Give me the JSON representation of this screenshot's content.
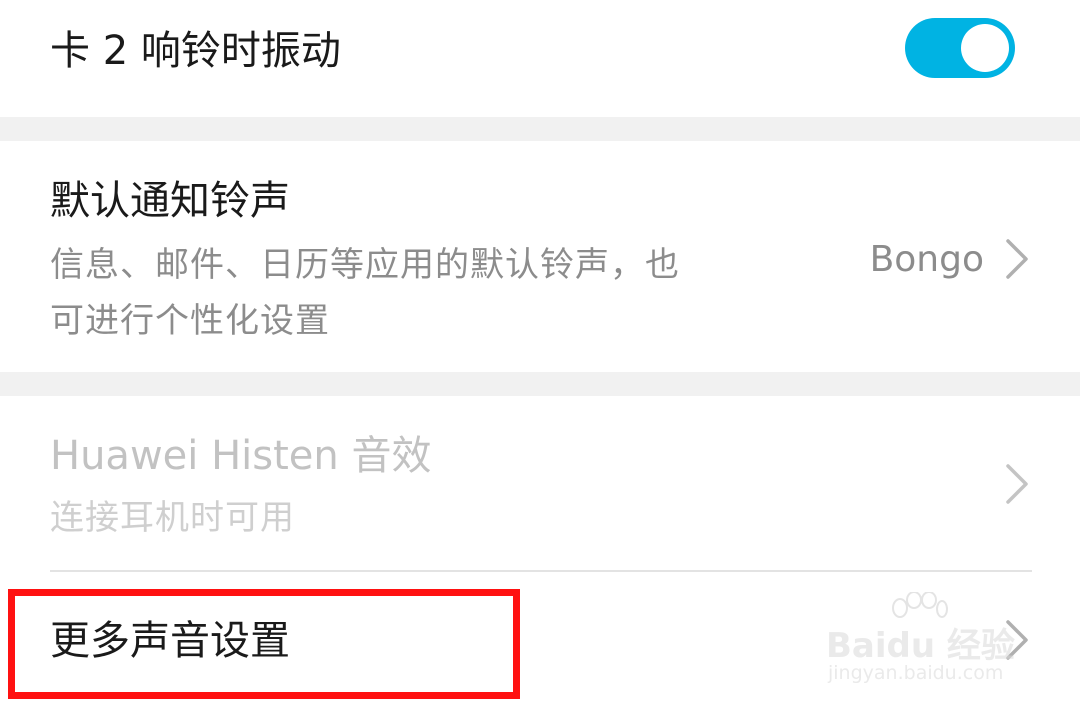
{
  "rows": {
    "card2_vibrate": {
      "title": "卡 2 响铃时振动",
      "toggle_on": true
    },
    "default_notification": {
      "title": "默认通知铃声",
      "description_line1": "信息、邮件、日历等应用的默认铃声，也",
      "description_line2": "可进行个性化设置",
      "value": "Bongo"
    },
    "histen": {
      "title": "Huawei Histen 音效",
      "description": "连接耳机时可用"
    },
    "more_sound": {
      "title": "更多声音设置"
    }
  },
  "watermark": {
    "brand": "Baidu 经验",
    "url": "jingyan.baidu.com"
  },
  "colors": {
    "toggle_accent": "#00b3e3",
    "highlight_border": "#ff1111",
    "section_gap": "#f1f1f1"
  },
  "icons": [
    "chevron-right-icon",
    "toggle-switch",
    "baidu-paw-icon"
  ]
}
